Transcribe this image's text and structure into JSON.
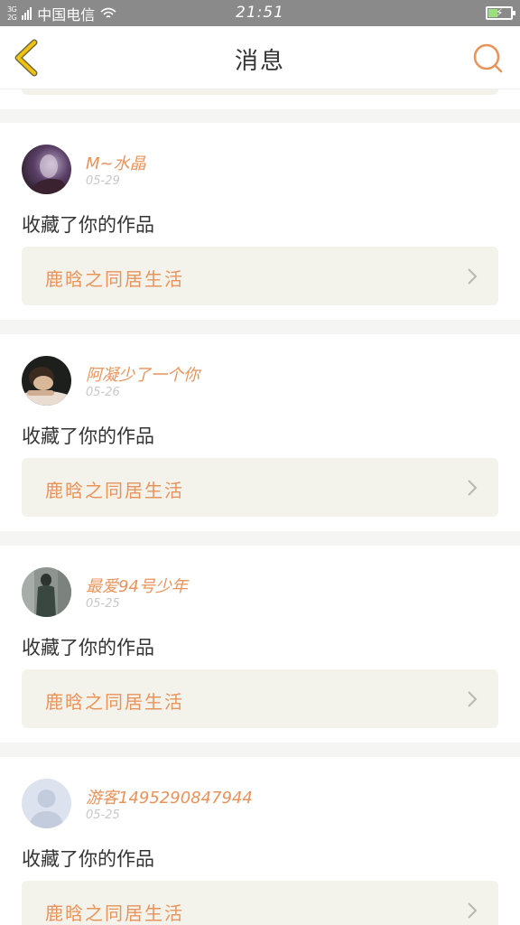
{
  "status_bar": {
    "network_top": "3G",
    "network_bottom": "2G",
    "carrier": "中国电信",
    "time": "21:51"
  },
  "nav": {
    "title": "消息",
    "back_icon": "chevron-left-icon",
    "search_icon": "search-icon"
  },
  "colors": {
    "accent": "#e8935a",
    "back_icon": "#f2c010",
    "card_bg": "#f3f3ec"
  },
  "messages": [
    {
      "username": "M~水晶",
      "date": "05-29",
      "action": "收藏了你的作品",
      "work_title": "鹿晗之同居生活"
    },
    {
      "username": "阿凝少了一个你",
      "date": "05-26",
      "action": "收藏了你的作品",
      "work_title": "鹿晗之同居生活"
    },
    {
      "username": "最爱94号少年",
      "date": "05-25",
      "action": "收藏了你的作品",
      "work_title": "鹿晗之同居生活"
    },
    {
      "username": "游客1495290847944",
      "date": "05-25",
      "action": "收藏了你的作品",
      "work_title": "鹿晗之同居生活"
    }
  ]
}
